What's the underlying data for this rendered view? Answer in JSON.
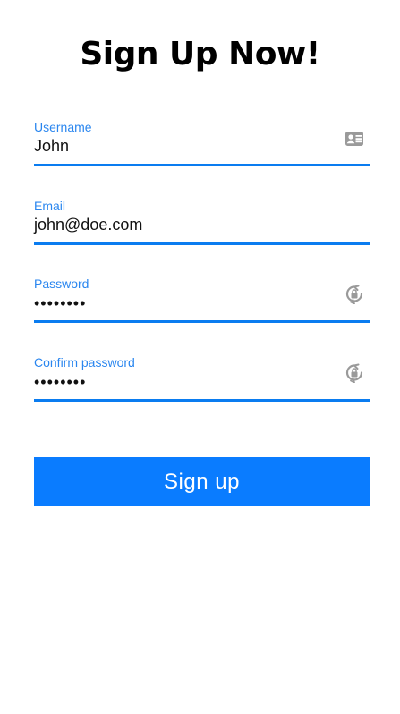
{
  "title": "Sign Up Now!",
  "colors": {
    "accent": "#0a7cff",
    "label": "#2a86ef",
    "icon": "#9a9a9a"
  },
  "form": {
    "username": {
      "label": "Username",
      "value": "John",
      "icon": "contact-card-icon"
    },
    "email": {
      "label": "Email",
      "value": "john@doe.com"
    },
    "password": {
      "label": "Password",
      "value": "••••••••",
      "icon": "lock-rotate-icon"
    },
    "confirm_password": {
      "label": "Confirm password",
      "value": "••••••••",
      "icon": "lock-rotate-icon"
    }
  },
  "submit_label": "Sign up"
}
